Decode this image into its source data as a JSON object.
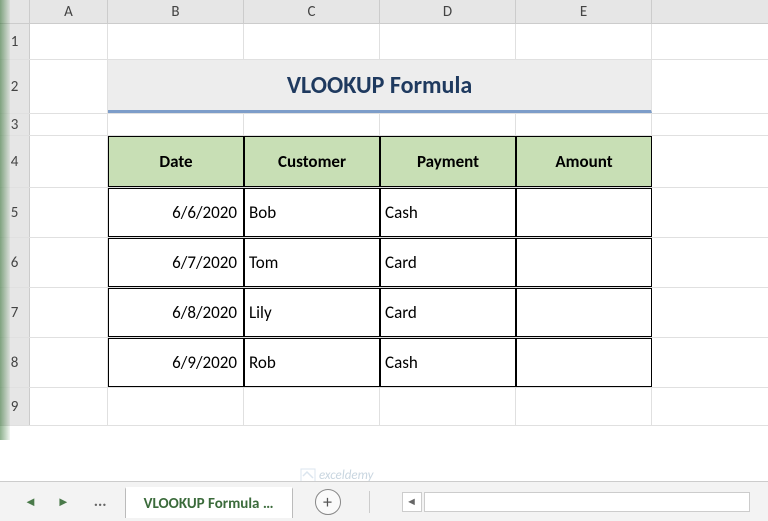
{
  "columns": [
    "A",
    "B",
    "C",
    "D",
    "E"
  ],
  "rows": [
    "1",
    "2",
    "3",
    "4",
    "5",
    "6",
    "7",
    "8",
    "9"
  ],
  "title": "VLOOKUP Formula",
  "headers": {
    "b": "Date",
    "c": "Customer",
    "d": "Payment",
    "e": "Amount"
  },
  "data": [
    {
      "date": "6/6/2020",
      "customer": "Bob",
      "payment": "Cash",
      "amount": ""
    },
    {
      "date": "6/7/2020",
      "customer": "Tom",
      "payment": "Card",
      "amount": ""
    },
    {
      "date": "6/8/2020",
      "customer": "Lily",
      "payment": "Card",
      "amount": ""
    },
    {
      "date": "6/9/2020",
      "customer": "Rob",
      "payment": "Cash",
      "amount": ""
    }
  ],
  "tabbar": {
    "dots_label": "...",
    "active_tab": "VLOOKUP Formula …",
    "new_tab_glyph": "+"
  },
  "watermark": "exceldemy",
  "chart_data": {
    "type": "table",
    "title": "VLOOKUP Formula",
    "columns": [
      "Date",
      "Customer",
      "Payment",
      "Amount"
    ],
    "rows": [
      [
        "6/6/2020",
        "Bob",
        "Cash",
        ""
      ],
      [
        "6/7/2020",
        "Tom",
        "Card",
        ""
      ],
      [
        "6/8/2020",
        "Lily",
        "Card",
        ""
      ],
      [
        "6/9/2020",
        "Rob",
        "Cash",
        ""
      ]
    ]
  }
}
